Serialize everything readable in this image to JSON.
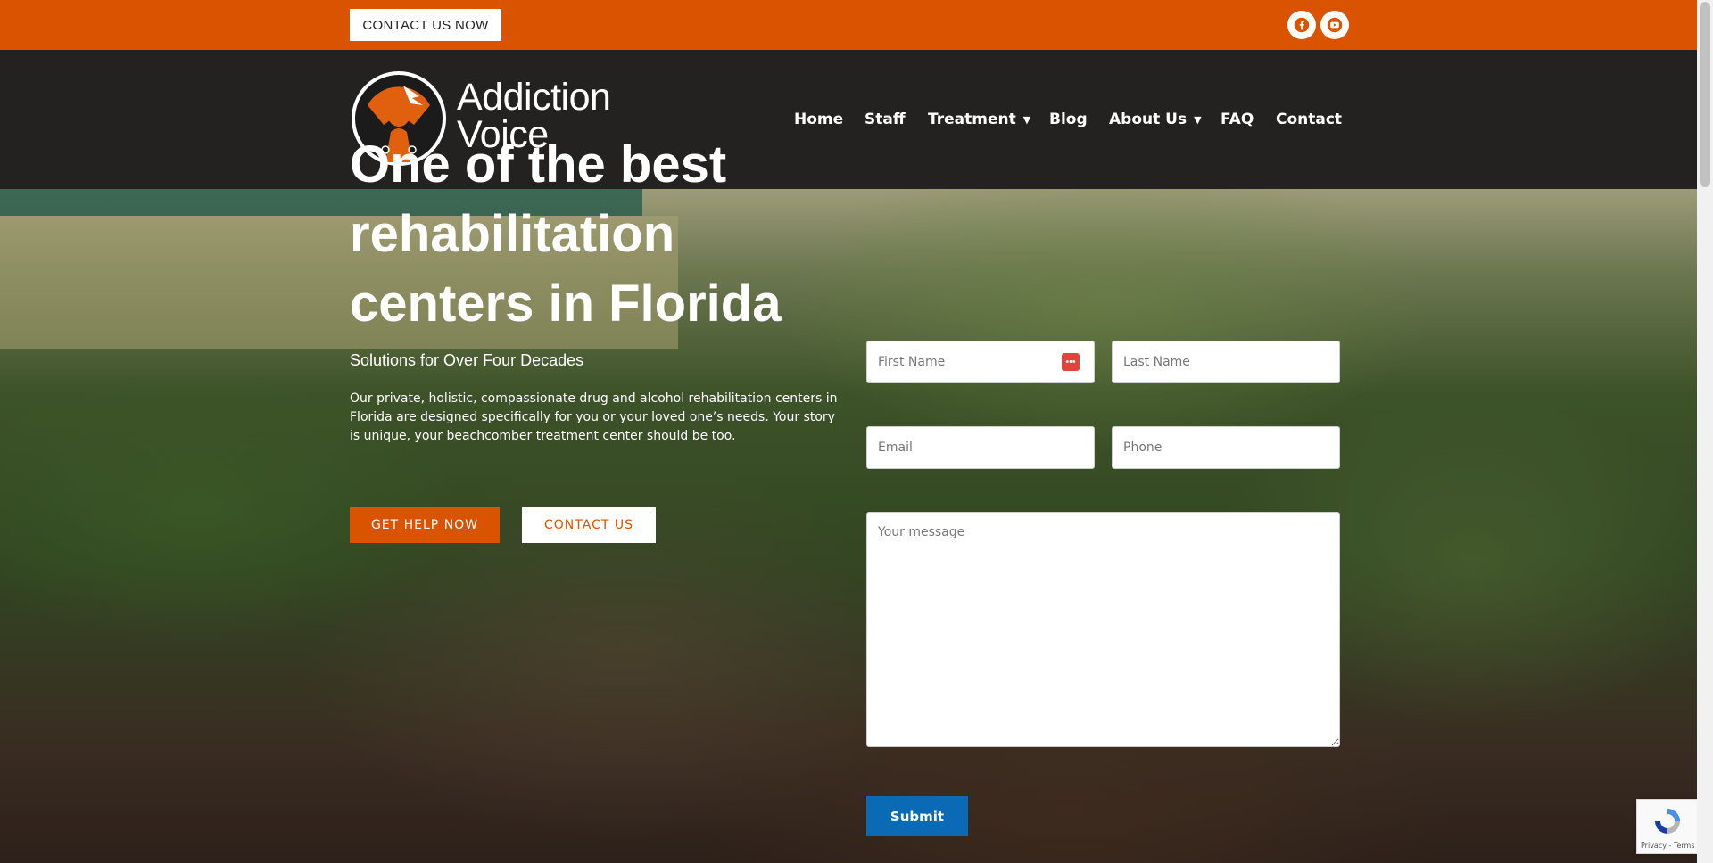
{
  "topbar": {
    "contact_button": "CONTACT US NOW",
    "social": [
      {
        "icon": "facebook-icon"
      },
      {
        "icon": "youtube-icon"
      }
    ],
    "color": "#d95300"
  },
  "header": {
    "brand_line1": "Addiction",
    "brand_line2": "Voice",
    "nav": [
      {
        "label": "Home"
      },
      {
        "label": "Staff"
      },
      {
        "label": "Treatment",
        "has_dropdown": true
      },
      {
        "label": "Blog"
      },
      {
        "label": "About Us",
        "has_dropdown": true
      },
      {
        "label": "FAQ"
      },
      {
        "label": "Contact"
      }
    ]
  },
  "hero": {
    "title": "One of the best rehabilitation centers in Florida",
    "subtitle": "Solutions for Over Four Decades",
    "description": "Our private, holistic, compassionate drug and alcohol rehabilitation centers in Florida are designed specifically for you or your loved one’s needs. Your story is unique, your beachcomber treatment center should be too.",
    "primary_button": "GET HELP NOW",
    "secondary_button": "CONTACT US"
  },
  "form": {
    "first_name_placeholder": "First Name",
    "last_name_placeholder": "Last Name",
    "email_placeholder": "Email",
    "phone_placeholder": "Phone",
    "message_placeholder": "Your message",
    "submit_label": "Submit"
  },
  "recaptcha": {
    "links": "Privacy - Terms"
  },
  "colors": {
    "accent": "#d95300",
    "header_bg": "#232221",
    "submit": "#0a6ab5"
  }
}
